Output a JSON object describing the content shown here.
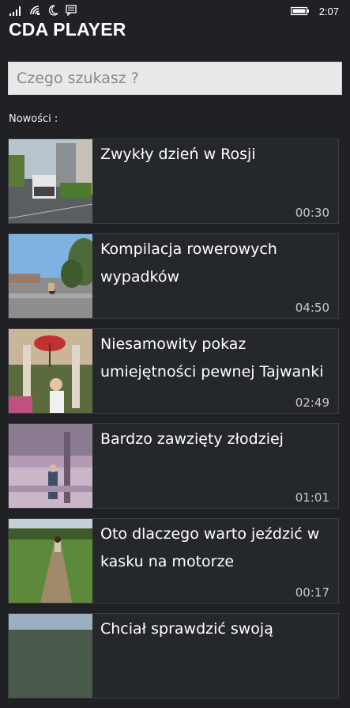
{
  "status_bar": {
    "time": "2:07",
    "icons": [
      "signal-icon",
      "wifi-icon",
      "quiet-hours-icon",
      "message-icon",
      "battery-icon"
    ]
  },
  "app": {
    "title": "CDA PLAYER"
  },
  "search": {
    "placeholder": "Czego szukasz ?",
    "value": ""
  },
  "section": {
    "label": "Nowości :"
  },
  "videos": [
    {
      "title": "Zwykły dzień w Rosji",
      "duration": "00:30"
    },
    {
      "title": "Kompilacja rowerowych wypadków",
      "duration": "04:50"
    },
    {
      "title": "Niesamowity pokaz umiejętności pewnej Tajwanki",
      "duration": "02:49"
    },
    {
      "title": "Bardzo zawzięty złodziej",
      "duration": "01:01"
    },
    {
      "title": "Oto dlaczego warto jeździć w kasku na motorze",
      "duration": "00:17"
    },
    {
      "title": "Chciał sprawdzić swoją",
      "duration": ""
    }
  ],
  "colors": {
    "background": "#1f2124",
    "card": "#25282b",
    "card_border": "#3a3d41",
    "search_bg": "#e9e9e9"
  }
}
